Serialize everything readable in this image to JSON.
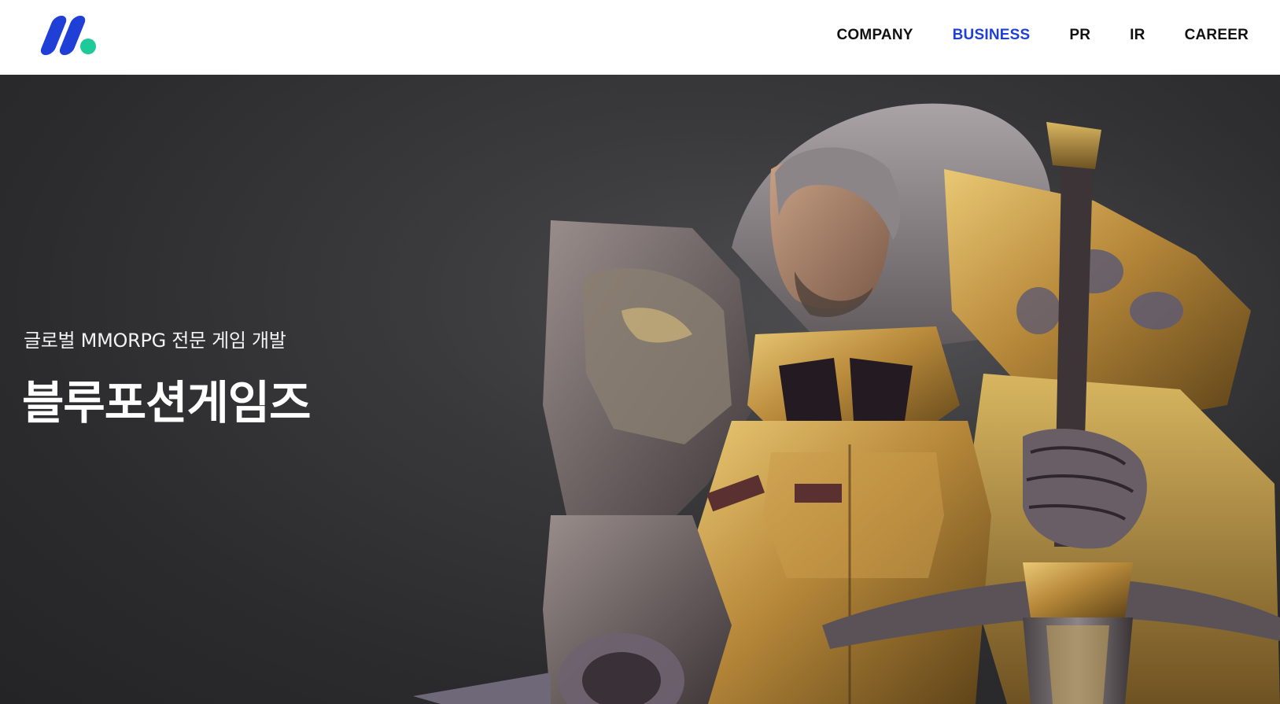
{
  "brand": {
    "logo_icon": "m-logo-icon",
    "primary_color": "#1f3fd6",
    "accent_color": "#1ec99a"
  },
  "nav": {
    "items": [
      {
        "label": "COMPANY",
        "active": false
      },
      {
        "label": "BUSINESS",
        "active": true
      },
      {
        "label": "PR",
        "active": false
      },
      {
        "label": "IR",
        "active": false
      },
      {
        "label": "CAREER",
        "active": false
      }
    ],
    "active_color": "#1f3fd6",
    "text_color": "#111111"
  },
  "hero": {
    "subtitle": "글로벌 MMORPG 전문 게임 개발",
    "title": "블루포션게임즈",
    "image": "armored-knight-with-sword-illustration"
  }
}
